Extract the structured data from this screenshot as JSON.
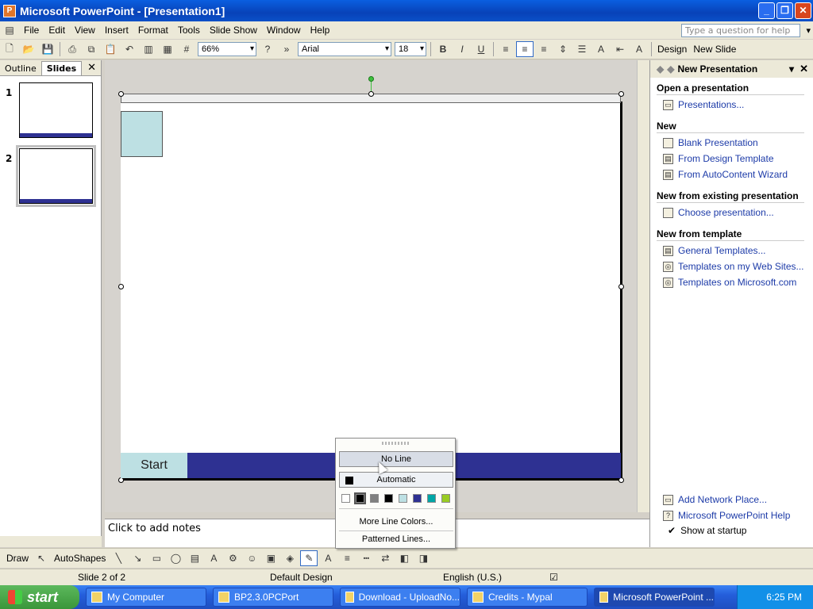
{
  "window": {
    "title": "Microsoft PowerPoint - [Presentation1]"
  },
  "menu": [
    "File",
    "Edit",
    "View",
    "Insert",
    "Format",
    "Tools",
    "Slide Show",
    "Window",
    "Help"
  ],
  "help_placeholder": "Type a question for help",
  "toolbar": {
    "zoom": "66%",
    "font": "Arial",
    "size": "18",
    "bold": "B",
    "italic": "I",
    "underline": "U",
    "design": "Design",
    "new_slide": "New Slide"
  },
  "left_panel": {
    "tab_outline": "Outline",
    "tab_slides": "Slides",
    "thumb1_num": "1",
    "thumb2_num": "2"
  },
  "slide": {
    "start_label": "Start"
  },
  "notes_placeholder": "Click to add notes",
  "taskpane": {
    "title": "New Presentation",
    "sec_open": "Open a presentation",
    "presentations": "Presentations...",
    "sec_new": "New",
    "blank": "Blank Presentation",
    "design_template": "From Design Template",
    "autocontent": "From AutoContent Wizard",
    "sec_existing": "New from existing presentation",
    "choose": "Choose presentation...",
    "sec_template": "New from template",
    "general": "General Templates...",
    "web_sites": "Templates on my Web Sites...",
    "ms_com": "Templates on Microsoft.com",
    "network": "Add Network Place...",
    "help": "Microsoft PowerPoint Help",
    "startup": "Show at startup"
  },
  "drawbar": {
    "draw": "Draw",
    "autoshapes": "AutoShapes"
  },
  "status": {
    "slide": "Slide 2 of 2",
    "design": "Default Design",
    "language": "English (U.S.)"
  },
  "popup": {
    "no_line": "No Line",
    "automatic": "Automatic",
    "more": "More Line Colors...",
    "patterned": "Patterned Lines..."
  },
  "colors": {
    "swatches": [
      "#ffffff",
      "#000000",
      "#808080",
      "#000000",
      "#bde0e3",
      "#2e3192",
      "#00a6a6",
      "#99cc22"
    ]
  },
  "taskbar": {
    "start": "start",
    "t1": "My Computer",
    "t2": "BP2.3.0PCPort",
    "t3": "Download - UploadNo...",
    "t4": "Credits - Mypal",
    "t5": "Microsoft PowerPoint ...",
    "clock": "6:25 PM"
  }
}
